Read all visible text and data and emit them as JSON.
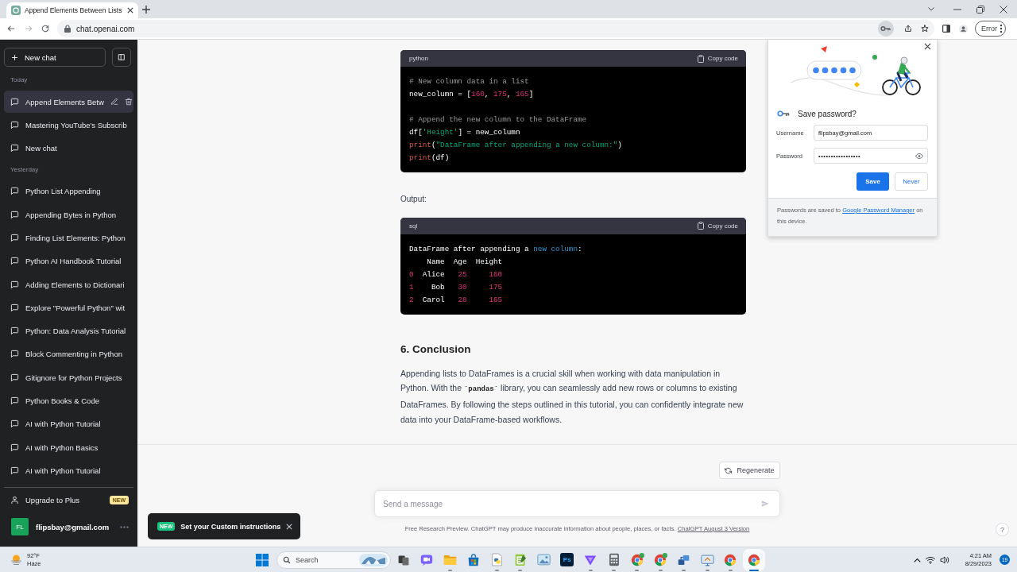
{
  "browser": {
    "tab_title": "Append Elements Between Lists",
    "address": "chat.openai.com",
    "forward_disabled": true,
    "key_active": true,
    "profile_chip": "Error"
  },
  "sidebar": {
    "new_chat": "New chat",
    "sections": [
      {
        "label": "Today",
        "items": [
          {
            "title": "Append Elements Betw",
            "selected": true
          },
          {
            "title": "Mastering YouTube's Subscrib",
            "selected": false
          },
          {
            "title": "New chat",
            "selected": false
          }
        ]
      },
      {
        "label": "Yesterday",
        "items": [
          {
            "title": "Python List Appending",
            "selected": false
          },
          {
            "title": "Appending Bytes in Python",
            "selected": false
          },
          {
            "title": "Finding List Elements: Python",
            "selected": false
          },
          {
            "title": "Python AI Handbook Tutorial",
            "selected": false
          },
          {
            "title": "Adding Elements to Dictionari",
            "selected": false
          },
          {
            "title": "Explore \"Powerful Python\" wit",
            "selected": false
          },
          {
            "title": "Python: Data Analysis Tutorial",
            "selected": false
          },
          {
            "title": "Block Commenting in Python",
            "selected": false
          },
          {
            "title": "Gitignore for Python Projects",
            "selected": false
          },
          {
            "title": "Python Books & Code",
            "selected": false
          },
          {
            "title": "AI with Python Tutorial",
            "selected": false
          },
          {
            "title": "AI with Python Basics",
            "selected": false
          },
          {
            "title": "AI with Python Tutorial",
            "selected": false
          }
        ]
      }
    ],
    "upgrade": {
      "label": "Upgrade to Plus",
      "badge": "NEW"
    },
    "account": {
      "initials": "FL",
      "email": "flipsbay@gmail.com"
    }
  },
  "chat": {
    "blocks": [
      {
        "kind": "code",
        "language": "python",
        "copy_label": "Copy code",
        "groups": [
          [
            [
              {
                "text": "# New column data in a list",
                "kind": "comment"
              }
            ],
            [
              {
                "text": "new_column = [",
                "kind": "plain"
              },
              {
                "text": "160",
                "kind": "number"
              },
              {
                "text": ", ",
                "kind": "plain"
              },
              {
                "text": "175",
                "kind": "number"
              },
              {
                "text": ", ",
                "kind": "plain"
              },
              {
                "text": "165",
                "kind": "number"
              },
              {
                "text": "]",
                "kind": "plain"
              }
            ]
          ],
          [
            [
              {
                "text": "# Append the new column to the DataFrame",
                "kind": "comment"
              }
            ],
            [
              {
                "text": "df[",
                "kind": "plain"
              },
              {
                "text": "'Height'",
                "kind": "string"
              },
              {
                "text": "] = new_column",
                "kind": "plain"
              }
            ],
            [
              {
                "text": "print",
                "kind": "builtin"
              },
              {
                "text": "(",
                "kind": "plain"
              },
              {
                "text": "\"DataFrame after appending a new column:\"",
                "kind": "string"
              },
              {
                "text": ")",
                "kind": "plain"
              }
            ],
            [
              {
                "text": "print",
                "kind": "builtin"
              },
              {
                "text": "(df)",
                "kind": "plain"
              }
            ]
          ]
        ]
      },
      {
        "kind": "text",
        "text": "Output:"
      },
      {
        "kind": "code",
        "language": "sql",
        "copy_label": "Copy code",
        "groups": [
          [
            [
              {
                "text": "DataFrame after appending a ",
                "kind": "plain"
              },
              {
                "text": "new column",
                "kind": "keyword"
              },
              {
                "text": ":",
                "kind": "plain"
              }
            ],
            [
              {
                "text": "    Name  Age  Height",
                "kind": "plain"
              }
            ],
            [
              {
                "text": "0",
                "kind": "number"
              },
              {
                "text": "  Alice   ",
                "kind": "plain"
              },
              {
                "text": "25     160",
                "kind": "number"
              }
            ],
            [
              {
                "text": "1",
                "kind": "number"
              },
              {
                "text": "    Bob   ",
                "kind": "plain"
              },
              {
                "text": "30     175",
                "kind": "number"
              }
            ],
            [
              {
                "text": "2",
                "kind": "number"
              },
              {
                "text": "  Carol   ",
                "kind": "plain"
              },
              {
                "text": "28     165",
                "kind": "number"
              }
            ]
          ]
        ]
      },
      {
        "kind": "heading",
        "text": "6. Conclusion"
      },
      {
        "kind": "paragraph",
        "text": "Appending lists to DataFrames is a crucial skill when working with data manipulation in Python. With the **`pandas`** library, you can seamlessly add new rows or columns to existing DataFrames. By following the steps outlined in this tutorial, you can confidently integrate new data into your DataFrame-based workflows."
      }
    ],
    "regenerate": "Regenerate",
    "composer": {
      "placeholder": "Send a message"
    },
    "disclaimer": {
      "text": "Free Research Preview. ChatGPT may produce inaccurate information about people, places, or facts.",
      "link": "ChatGPT August 3 Version"
    },
    "help": "?"
  },
  "tooltip": {
    "badge": "NEW",
    "text": "Set your Custom instructions"
  },
  "password_dialog": {
    "title": "Save password?",
    "fields": [
      {
        "kind": "text",
        "label": "Username",
        "value": "flipsbay@gmail.com"
      },
      {
        "kind": "password",
        "label": "Password",
        "value": "•••••••••••••••••"
      }
    ],
    "buttons": [
      {
        "kind": "primary",
        "label": "Save"
      },
      {
        "kind": "secondary",
        "label": "Never"
      }
    ],
    "footer": {
      "before": "Passwords are saved to",
      "link": "Google Password Manager",
      "after": "on this device."
    }
  },
  "taskbar": {
    "weather": {
      "temperature": "92°F",
      "condition": "Haze"
    },
    "search": "Search",
    "apps": [
      {
        "kind": "task-view",
        "badge": false,
        "running": false,
        "selected": false
      },
      {
        "kind": "chat",
        "badge": false,
        "running": false,
        "selected": false
      },
      {
        "kind": "folder",
        "badge": false,
        "running": true,
        "selected": false
      },
      {
        "kind": "store",
        "badge": false,
        "running": false,
        "selected": false
      },
      {
        "kind": "python",
        "badge": false,
        "running": true,
        "selected": false
      },
      {
        "kind": "notepad",
        "badge": false,
        "running": true,
        "selected": false
      },
      {
        "kind": "photos",
        "badge": false,
        "running": false,
        "selected": false
      },
      {
        "kind": "photoshop",
        "label": "Ps",
        "badge": false,
        "running": false,
        "selected": false
      },
      {
        "kind": "vpn",
        "badge": false,
        "running": true,
        "selected": false
      },
      {
        "kind": "calculator",
        "badge": false,
        "running": true,
        "selected": false
      },
      {
        "kind": "browser",
        "badge": true,
        "running": true,
        "selected": false
      },
      {
        "kind": "browser",
        "badge": true,
        "running": true,
        "selected": false
      },
      {
        "kind": "network",
        "badge": false,
        "running": true,
        "selected": false
      },
      {
        "kind": "remote",
        "badge": false,
        "running": true,
        "selected": false
      },
      {
        "kind": "browser",
        "badge": false,
        "running": true,
        "selected": false
      },
      {
        "kind": "browser",
        "badge": false,
        "running": true,
        "selected": true
      }
    ],
    "time": "4:21 AM",
    "date": "8/29/2023",
    "notifications": "19"
  }
}
